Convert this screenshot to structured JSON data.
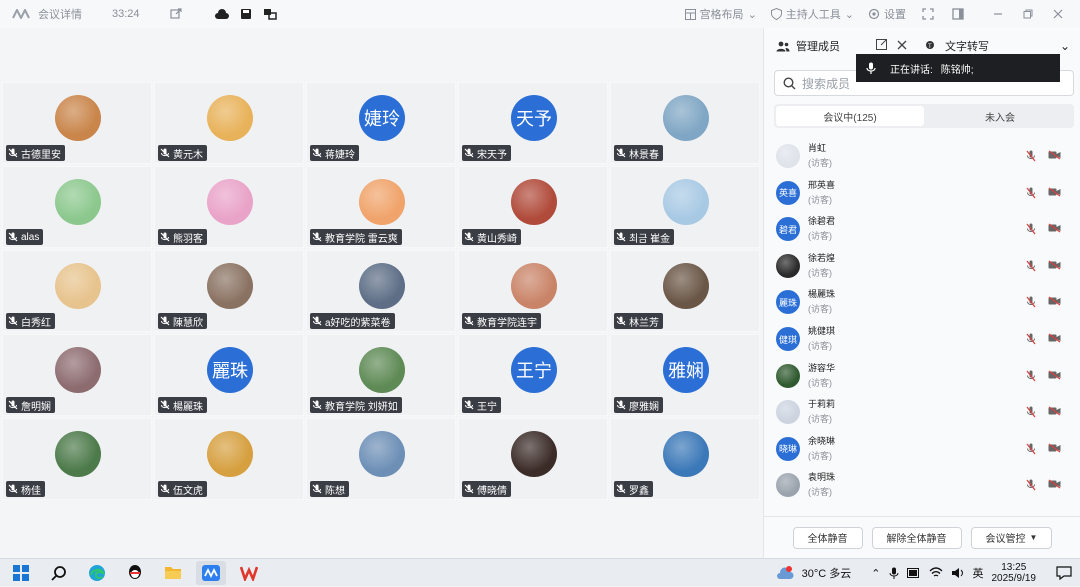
{
  "titlebar": {
    "title": "会议详情",
    "time": "33:24",
    "layout_label": "宫格布局",
    "host_label": "主持人工具",
    "settings_label": "设置"
  },
  "grid": {
    "participants": [
      {
        "name": "古德里安",
        "avatar": {
          "type": "image",
          "color": "#c9854a"
        }
      },
      {
        "name": "黄元木",
        "avatar": {
          "type": "image",
          "color": "#e8b25a"
        }
      },
      {
        "name": "蒋婕玲",
        "avatar": {
          "type": "text",
          "text": "婕玲",
          "color": "#2b6fd6"
        }
      },
      {
        "name": "宋天予",
        "avatar": {
          "type": "text",
          "text": "天予",
          "color": "#2b6fd6"
        }
      },
      {
        "name": "林景春",
        "avatar": {
          "type": "image",
          "color": "#7fa6c4"
        }
      },
      {
        "name": "alas",
        "avatar": {
          "type": "image",
          "color": "#8cc88e"
        }
      },
      {
        "name": "熊羽客",
        "avatar": {
          "type": "image",
          "color": "#e9a3c8"
        }
      },
      {
        "name": "教育学院 雷云爽",
        "avatar": {
          "type": "image",
          "color": "#f0a36a"
        }
      },
      {
        "name": "黄山秀崎",
        "avatar": {
          "type": "image",
          "color": "#b04a3a"
        }
      },
      {
        "name": "최금 崔金",
        "avatar": {
          "type": "image",
          "color": "#a8c9e4"
        }
      },
      {
        "name": "白秀红",
        "avatar": {
          "type": "image",
          "color": "#e7c38d"
        }
      },
      {
        "name": "陳慧欣",
        "avatar": {
          "type": "image",
          "color": "#8a7262"
        }
      },
      {
        "name": "a好吃的紫菜卷",
        "avatar": {
          "type": "image",
          "color": "#5d6e86"
        }
      },
      {
        "name": "教育学院连宇",
        "avatar": {
          "type": "image",
          "color": "#c98468"
        }
      },
      {
        "name": "林兰芳",
        "avatar": {
          "type": "image",
          "color": "#6a5646"
        }
      },
      {
        "name": "詹明娴",
        "avatar": {
          "type": "image",
          "color": "#8d6c70"
        }
      },
      {
        "name": "楊麗珠",
        "avatar": {
          "type": "text",
          "text": "麗珠",
          "color": "#2b6fd6"
        }
      },
      {
        "name": "教育学院 刘妍如",
        "avatar": {
          "type": "image",
          "color": "#5e8a55"
        }
      },
      {
        "name": "王宁",
        "avatar": {
          "type": "text",
          "text": "王宁",
          "color": "#2b6fd6"
        }
      },
      {
        "name": "廖雅娴",
        "avatar": {
          "type": "text",
          "text": "雅娴",
          "color": "#2b6fd6"
        }
      },
      {
        "name": "杨佳",
        "avatar": {
          "type": "image",
          "color": "#4c7a4a"
        }
      },
      {
        "name": "伍文虎",
        "avatar": {
          "type": "image",
          "color": "#d6a040"
        }
      },
      {
        "name": "陈想",
        "avatar": {
          "type": "image",
          "color": "#6d8fb6"
        }
      },
      {
        "name": "傅晓倩",
        "avatar": {
          "type": "image",
          "color": "#3b2c28"
        }
      },
      {
        "name": "罗鑫",
        "avatar": {
          "type": "image",
          "color": "#3b78b8"
        }
      }
    ]
  },
  "panel": {
    "tab_members": "管理成员",
    "tab_transcribe": "文字转写",
    "search_placeholder": "搜索成员",
    "seg_in_meeting": "会议中(125)",
    "seg_not_joined": "未入会",
    "speaking_label": "正在讲话:",
    "speaking_name": "陈铭帅;",
    "members": [
      {
        "name": "肖虹",
        "role": "(访客)",
        "avatar": {
          "type": "image",
          "color": "#dfe3ea"
        }
      },
      {
        "name": "邢英喜",
        "role": "(访客)",
        "avatar": {
          "type": "text",
          "text": "英喜",
          "color": "#2b6fd6"
        }
      },
      {
        "name": "徐碧君",
        "role": "(访客)",
        "avatar": {
          "type": "text",
          "text": "碧君",
          "color": "#2b6fd6"
        }
      },
      {
        "name": "徐若煌",
        "role": "(访客)",
        "avatar": {
          "type": "image",
          "color": "#2a2a2a"
        }
      },
      {
        "name": "楊麗珠",
        "role": "(访客)",
        "avatar": {
          "type": "text",
          "text": "麗珠",
          "color": "#2b6fd6"
        }
      },
      {
        "name": "姚健琪",
        "role": "(访客)",
        "avatar": {
          "type": "text",
          "text": "健琪",
          "color": "#2b6fd6"
        }
      },
      {
        "name": "游容华",
        "role": "(访客)",
        "avatar": {
          "type": "image",
          "color": "#2f5a2f"
        }
      },
      {
        "name": "于莉莉",
        "role": "(访客)",
        "avatar": {
          "type": "image",
          "color": "#ccd4e0"
        }
      },
      {
        "name": "余晓琳",
        "role": "(访客)",
        "avatar": {
          "type": "text",
          "text": "晓琳",
          "color": "#2b6fd6"
        }
      },
      {
        "name": "袁明珠",
        "role": "(访客)",
        "avatar": {
          "type": "image",
          "color": "#9aa3ad"
        }
      }
    ],
    "btn_mute_all": "全体静音",
    "btn_unmute_all": "解除全体静音",
    "btn_control": "会议管控"
  },
  "taskbar": {
    "weather": "30°C 多云",
    "lang": "英",
    "time": "13:25",
    "date": "2025/9/19"
  },
  "colors": {
    "accent": "#2b6fd6",
    "nametag_bg": "#3a3d44",
    "mute_red": "#d94040"
  }
}
